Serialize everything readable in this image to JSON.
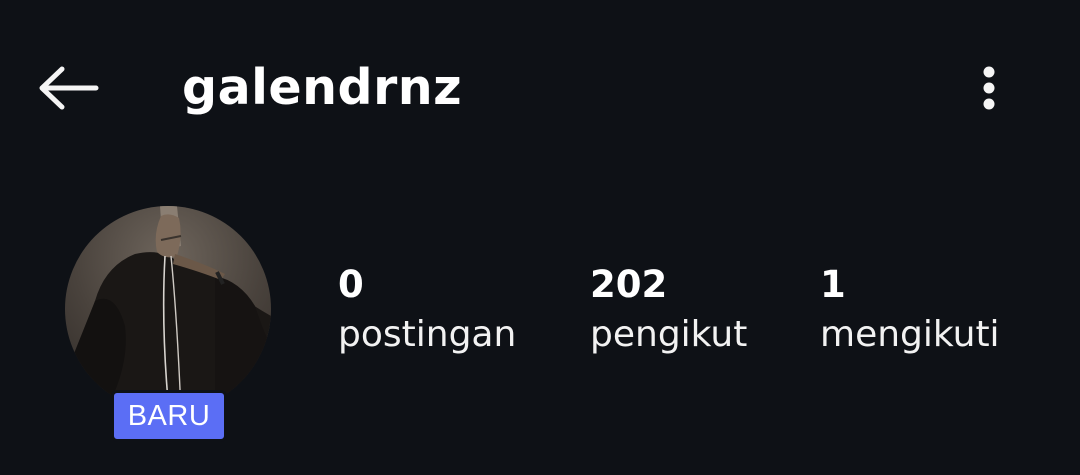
{
  "header": {
    "back_icon": "arrow-left-icon",
    "username": "galendrnz",
    "more_icon": "more-vertical-icon"
  },
  "profile": {
    "badge": "BARU",
    "stats": [
      {
        "value": "0",
        "label": "postingan"
      },
      {
        "value": "202",
        "label": "pengikut"
      },
      {
        "value": "1",
        "label": "mengikuti"
      }
    ]
  },
  "colors": {
    "background": "#0e1116",
    "text": "#ffffff",
    "badge": "#5b6ef5"
  }
}
